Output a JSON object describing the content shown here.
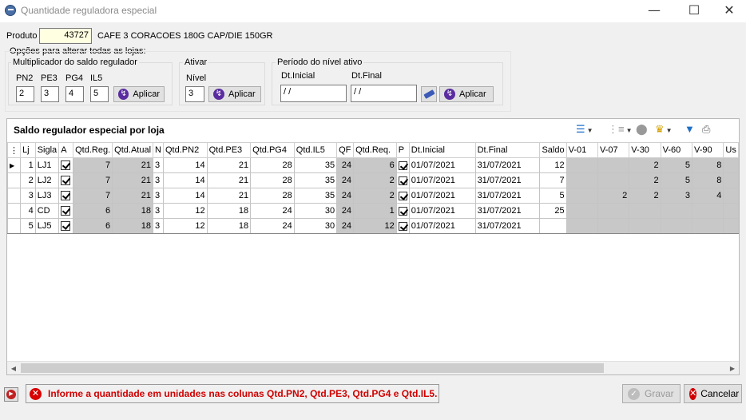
{
  "window": {
    "title": "Quantidade reguladora especial"
  },
  "produto": {
    "label": "Produto",
    "code": "43727",
    "description": "CAFE 3 CORACOES 180G CAP/DIE  150GR"
  },
  "options_label": "Opções para alterar todas as lojas:",
  "multiplicador": {
    "title": "Multiplicador do saldo regulador",
    "fields": [
      {
        "label": "PN2",
        "value": "2"
      },
      {
        "label": "PE3",
        "value": "3"
      },
      {
        "label": "PG4",
        "value": "4"
      },
      {
        "label": "IL5",
        "value": "5"
      }
    ],
    "apply_label": "Aplicar"
  },
  "ativar": {
    "title": "Ativar",
    "nivel_label": "Nível",
    "nivel_value": "3",
    "apply_label": "Aplicar"
  },
  "periodo": {
    "title": "Período do nível ativo",
    "dt_inicial_label": "Dt.Inicial",
    "dt_inicial_value": " / /",
    "dt_final_label": "Dt.Final",
    "dt_final_value": " / /",
    "apply_label": "Aplicar"
  },
  "grid": {
    "title": "Saldo regulador especial por loja",
    "columns": [
      "Lj",
      "Sigla",
      "A",
      "Qtd.Reg.",
      "Qtd.Atual",
      "N",
      "Qtd.PN2",
      "Qtd.PE3",
      "Qtd.PG4",
      "Qtd.IL5",
      "QF",
      "Qtd.Req.",
      "P",
      "Dt.Inicial",
      "Dt.Final",
      "Saldo",
      "V-01",
      "V-07",
      "V-30",
      "V-60",
      "V-90",
      "Us"
    ],
    "rows": [
      {
        "lj": "1",
        "sigla": "LJ1",
        "qtd_reg": "7",
        "qtd_atual": "21",
        "n": "3",
        "pn2": "14",
        "pe3": "21",
        "pg4": "28",
        "il5": "35",
        "qf": "24",
        "qtd_req": "6",
        "dt_inicial": "01/07/2021",
        "dt_final": "31/07/2021",
        "saldo": "12",
        "v01": "",
        "v07": "",
        "v30": "2",
        "v60": "5",
        "v90": "8"
      },
      {
        "lj": "2",
        "sigla": "LJ2",
        "qtd_reg": "7",
        "qtd_atual": "21",
        "n": "3",
        "pn2": "14",
        "pe3": "21",
        "pg4": "28",
        "il5": "35",
        "qf": "24",
        "qtd_req": "2",
        "dt_inicial": "01/07/2021",
        "dt_final": "31/07/2021",
        "saldo": "7",
        "v01": "",
        "v07": "",
        "v30": "2",
        "v60": "5",
        "v90": "8"
      },
      {
        "lj": "3",
        "sigla": "LJ3",
        "qtd_reg": "7",
        "qtd_atual": "21",
        "n": "3",
        "pn2": "14",
        "pe3": "21",
        "pg4": "28",
        "il5": "35",
        "qf": "24",
        "qtd_req": "2",
        "dt_inicial": "01/07/2021",
        "dt_final": "31/07/2021",
        "saldo": "5",
        "v01": "",
        "v07": "2",
        "v30": "2",
        "v60": "3",
        "v90": "4"
      },
      {
        "lj": "4",
        "sigla": "CD",
        "qtd_reg": "6",
        "qtd_atual": "18",
        "n": "3",
        "pn2": "12",
        "pe3": "18",
        "pg4": "24",
        "il5": "30",
        "qf": "24",
        "qtd_req": "1",
        "dt_inicial": "01/07/2021",
        "dt_final": "31/07/2021",
        "saldo": "25",
        "v01": "",
        "v07": "",
        "v30": "",
        "v60": "",
        "v90": ""
      },
      {
        "lj": "5",
        "sigla": "LJ5",
        "qtd_reg": "6",
        "qtd_atual": "18",
        "n": "3",
        "pn2": "12",
        "pe3": "18",
        "pg4": "24",
        "il5": "30",
        "qf": "24",
        "qtd_req": "12",
        "dt_inicial": "01/07/2021",
        "dt_final": "31/07/2021",
        "saldo": "",
        "v01": "",
        "v07": "",
        "v30": "",
        "v60": "",
        "v90": ""
      }
    ]
  },
  "message": "Informe a quantidade em unidades nas colunas Qtd.PN2, Qtd.PE3, Qtd.PG4 e Qtd.IL5.",
  "buttons": {
    "gravar": "Gravar",
    "cancelar": "Cancelar"
  }
}
